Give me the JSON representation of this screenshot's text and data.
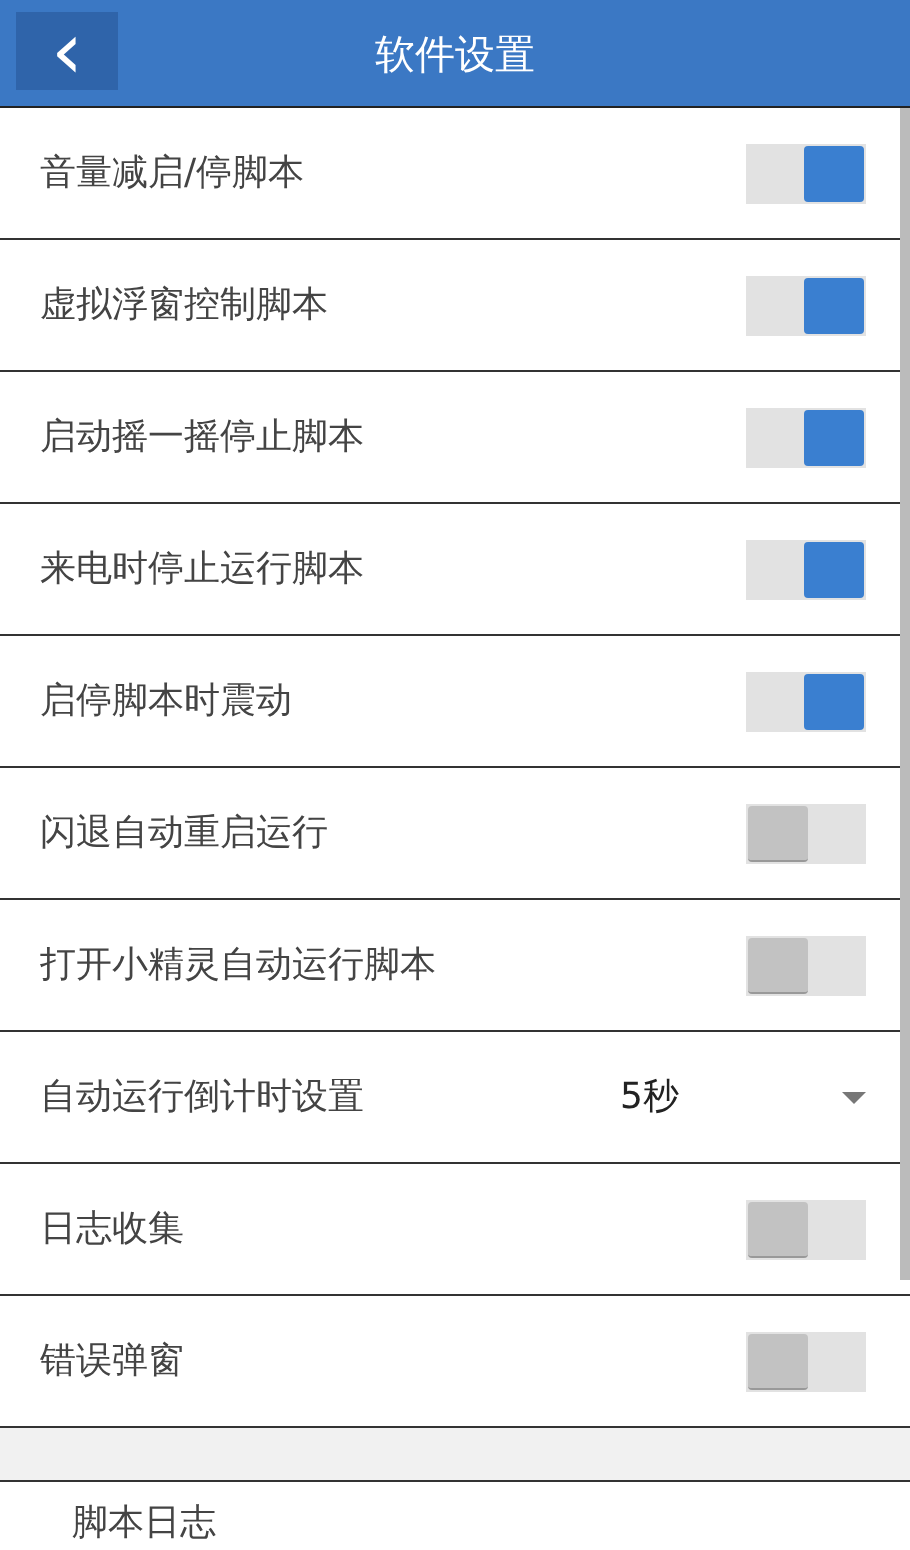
{
  "header": {
    "title": "软件设置",
    "back": "‹"
  },
  "settings": [
    {
      "kind": "toggle",
      "label": "音量减启/停脚本",
      "on": true
    },
    {
      "kind": "toggle",
      "label": "虚拟浮窗控制脚本",
      "on": true
    },
    {
      "kind": "toggle",
      "label": "启动摇一摇停止脚本",
      "on": true
    },
    {
      "kind": "toggle",
      "label": "来电时停止运行脚本",
      "on": true
    },
    {
      "kind": "toggle",
      "label": "启停脚本时震动",
      "on": true
    },
    {
      "kind": "toggle",
      "label": "闪退自动重启运行",
      "on": false
    },
    {
      "kind": "toggle",
      "label": "打开小精灵自动运行脚本",
      "on": false
    },
    {
      "kind": "select",
      "label": "自动运行倒计时设置",
      "value": "5秒"
    },
    {
      "kind": "toggle",
      "label": "日志收集",
      "on": false
    },
    {
      "kind": "toggle",
      "label": "错误弹窗",
      "on": false
    }
  ],
  "next_section": {
    "label": "脚本日志"
  }
}
